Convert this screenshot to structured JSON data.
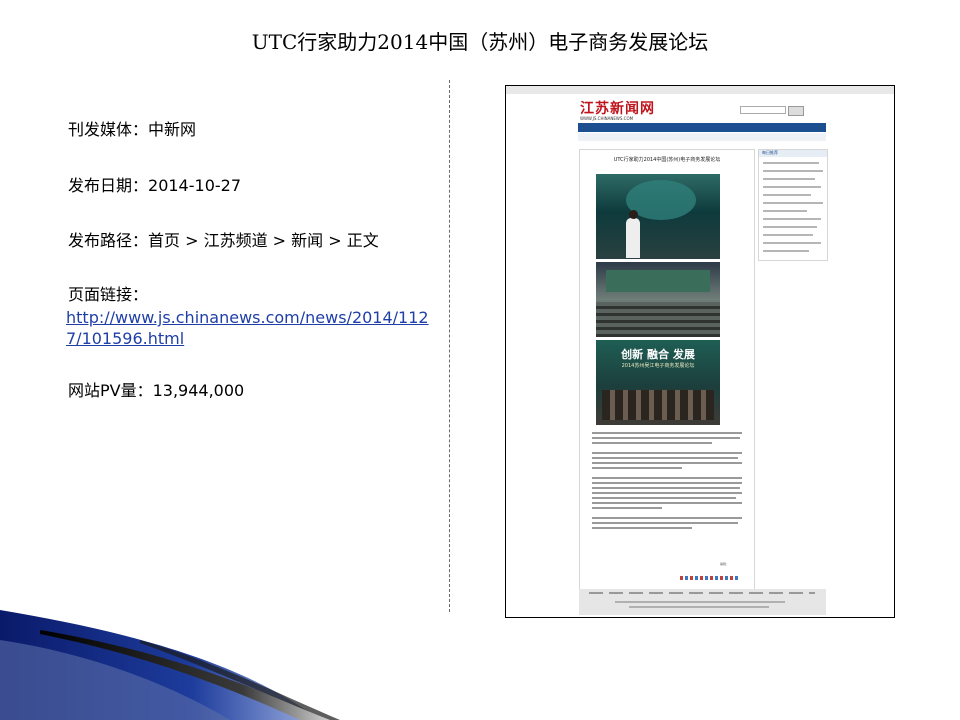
{
  "slide": {
    "title": "UTC行家助力2014中国（苏州）电子商务发展论坛"
  },
  "info": {
    "media_label": "刊发媒体：",
    "media_value": "中新网",
    "date_label": "发布日期：",
    "date_value": "2014-10-27",
    "path_label": "发布路径：",
    "path_value": "首页 > 江苏频道 > 新闻 > 正文",
    "link_label": "页面链接：",
    "link_value": "http://www.js.chinanews.com/news/2014/1127/101596.html",
    "pv_label": "网站PV量：",
    "pv_value": "13,944,000"
  },
  "screenshot": {
    "logo": "江苏新闻网",
    "logo_sub": "WWW.JS.CHINANEWS.COM",
    "article_title": "UTC行家助力2014中国(苏州)电子商务发展论坛",
    "banner_text": "创新 融合 发展",
    "banner_sub": "2014苏州吴江电子商务发展论坛",
    "sidebar_header": "每日推荐",
    "editor": "编辑：",
    "colors": {
      "nav": "#1c4f8f",
      "logo": "#c0141c",
      "link": "#1f3fa8"
    }
  }
}
